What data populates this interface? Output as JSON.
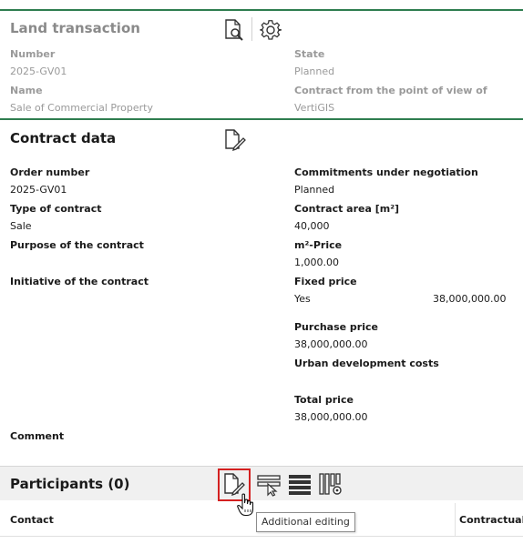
{
  "header": {
    "title": "Land transaction",
    "fields": [
      {
        "label": "Number",
        "value": "2025-GV01"
      },
      {
        "label": "State",
        "value": "Planned"
      },
      {
        "label": "Name",
        "value": "Sale of Commercial Property"
      },
      {
        "label": "Contract from the point of view of",
        "value": "VertiGIS"
      }
    ],
    "icons": [
      "document-search-icon",
      "gear-icon"
    ]
  },
  "contract": {
    "title": "Contract data",
    "icon": "edit-document-icon",
    "left": [
      {
        "label": "Order number",
        "value": "2025-GV01"
      },
      {
        "label": "Type of contract",
        "value": "Sale"
      },
      {
        "label": "Purpose of the contract",
        "value": ""
      },
      {
        "label": "Initiative of the contract",
        "value": ""
      },
      {
        "label": "Comment",
        "value": ""
      }
    ],
    "right": [
      {
        "label": "Commitments under negotiation",
        "value": "Planned"
      },
      {
        "label": "Contract area [m²]",
        "value": "40,000"
      },
      {
        "label": "m²-Price",
        "value": "1,000.00"
      },
      {
        "label": "Fixed price",
        "value": "Yes",
        "value2": "38,000,000.00"
      },
      {
        "label": "Purchase price",
        "value": "38,000,000.00"
      },
      {
        "label": "Urban development costs",
        "value": ""
      },
      {
        "label": "Total price",
        "value": "38,000,000.00"
      }
    ]
  },
  "participants": {
    "title": "Participants (0)",
    "icons": [
      "edit-document-icon",
      "select-feature-icon",
      "list-icon",
      "column-settings-icon"
    ],
    "columns": [
      "Contact",
      "Contractual"
    ],
    "tooltip": "Additional editing"
  },
  "colors": {
    "accent_green": "#2e7d4f",
    "highlight_red": "#d42020",
    "muted_text": "#9a9a9a"
  }
}
